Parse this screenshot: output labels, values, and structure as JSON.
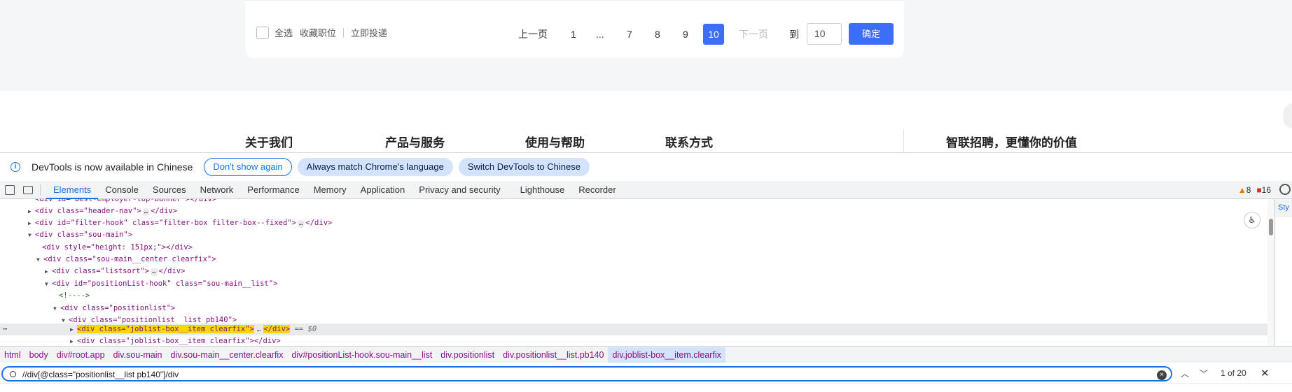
{
  "pager": {
    "select_all": "全选",
    "favorite": "收藏职位",
    "apply_now": "立即投递",
    "prev": "上一页",
    "pages": [
      "1",
      "...",
      "7",
      "8",
      "9"
    ],
    "current_page": "10",
    "next": "下一页",
    "goto_label": "到",
    "goto_value": "10",
    "confirm": "确定"
  },
  "footer": {
    "about": "关于我们",
    "products": "产品与服务",
    "help": "使用与帮助",
    "contact": "联系方式",
    "slogan": "智联招聘，更懂你的价值"
  },
  "infobar": {
    "message": "DevTools is now available in Chinese",
    "dont_show": "Don't show again",
    "match_lang": "Always match Chrome's language",
    "switch": "Switch DevTools to Chinese"
  },
  "tabs": [
    "Elements",
    "Console",
    "Sources",
    "Network",
    "Performance",
    "Memory",
    "Application",
    "Privacy and security",
    "Lighthouse",
    "Recorder"
  ],
  "issues": {
    "warnings": "8",
    "messages": "16"
  },
  "dom": {
    "l0": "<div id=\"best-employer-top-banner\"></div>",
    "l1_tag": "<div class=\"header-nav\">",
    "l1_close": "</div>",
    "l2_tag": "<div id=\"filter-hook\" class=\"filter-box filter-box--fixed\">",
    "l2_close": "</div>",
    "l3": "<div class=\"sou-main\">",
    "l4": "<div style=\"height: 151px;\"></div>",
    "l5": "<div class=\"sou-main__center clearfix\">",
    "l6_tag": "<div class=\"listsort\">",
    "l6_close": "</div>",
    "l7": "<div id=\"positionList-hook\" class=\"sou-main__list\">",
    "l8": "<!---->",
    "l9": "<div class=\"positionlist\">",
    "l10": "<div class=\"positionlist__list pb140\">",
    "l11_tag": "<div class=\"joblist-box__item clearfix\">",
    "l11_close": "</div>",
    "l11_ref": "== $0",
    "l12": "<div class=\"joblist-box__item clearfix\"></div>"
  },
  "breadcrumb": [
    "html",
    "body",
    "div#root.app",
    "div.sou-main",
    "div.sou-main__center.clearfix",
    "div#positionList-hook.sou-main__list",
    "div.positionlist",
    "div.positionlist__list.pb140",
    "div.joblist-box__item.clearfix"
  ],
  "search": {
    "query": "//div[@class=\"positionlist__list pb140\"]/div",
    "count": "1 of 20"
  },
  "styles_tab": "Sty"
}
